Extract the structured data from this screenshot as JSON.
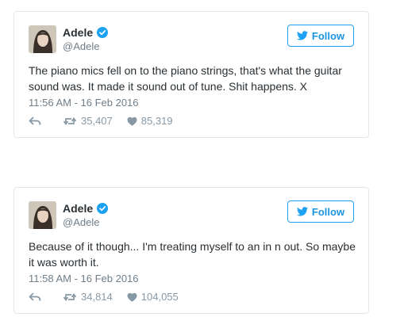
{
  "tweets": [
    {
      "name": "Adele",
      "handle": "@Adele",
      "follow_label": "Follow",
      "text": "The piano mics fell on to the piano strings, that's what the guitar sound was. It made it sound out of tune. Shit happens. X",
      "timestamp": "11:56 AM - 16 Feb 2016",
      "retweets": "35,407",
      "likes": "85,319"
    },
    {
      "name": "Adele",
      "handle": "@Adele",
      "follow_label": "Follow",
      "text": "Because of it though... I'm treating myself to an in n out. So maybe it was worth it.",
      "timestamp": "11:58 AM - 16 Feb 2016",
      "retweets": "34,814",
      "likes": "104,055"
    }
  ],
  "colors": {
    "accent": "#1da1f2",
    "border": "#e1e8ed",
    "muted": "#707e88",
    "icon": "#8899a6"
  },
  "icons": [
    "verified-badge-icon",
    "twitter-bird-icon",
    "reply-icon",
    "retweet-icon",
    "heart-icon"
  ]
}
